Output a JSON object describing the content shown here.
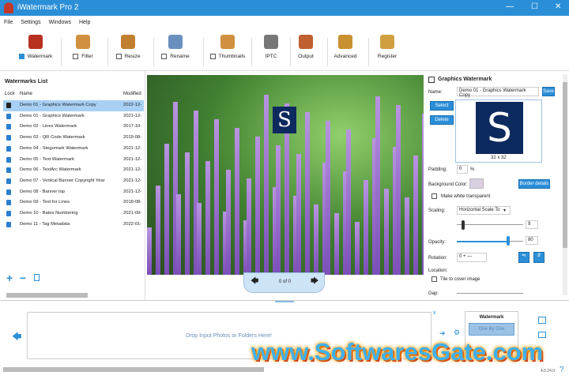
{
  "window": {
    "title": "iWatermark Pro 2",
    "minimize": "—",
    "maximize": "☐",
    "close": "✕"
  },
  "menu": [
    "File",
    "Settings",
    "Windows",
    "Help"
  ],
  "toolbar": [
    {
      "label": "Watermark",
      "checkbox": true,
      "checked": true,
      "icon": "stamp-icon"
    },
    {
      "label": "Filter",
      "checkbox": true,
      "checked": false,
      "icon": "funnel-icon"
    },
    {
      "label": "Resize",
      "checkbox": true,
      "checked": false,
      "icon": "resize-icon"
    },
    {
      "label": "Rename",
      "checkbox": true,
      "checked": false,
      "icon": "rename-icon"
    },
    {
      "label": "Thumbnails",
      "checkbox": true,
      "checked": false,
      "icon": "thumbnails-icon"
    },
    {
      "label": "IPTC",
      "checkbox": false,
      "icon": "id-card-icon"
    },
    {
      "label": "Output",
      "checkbox": false,
      "icon": "output-icon"
    },
    {
      "label": "Advanced",
      "checkbox": false,
      "icon": "gear-icon"
    },
    {
      "label": "Register",
      "checkbox": false,
      "icon": "key-icon"
    }
  ],
  "watermarks_list": {
    "title": "Watermarks List",
    "columns": [
      "Lock",
      "Name",
      "Modified"
    ],
    "rows": [
      {
        "name": "Demo 01 - Graphics Watermark Copy",
        "modified": "2022-12-",
        "selected": true,
        "locked": false
      },
      {
        "name": "Demo 01 - Graphics Watermark",
        "modified": "2021-12-",
        "locked": true
      },
      {
        "name": "Demo 02 - Lines Watermark",
        "modified": "2017-10-",
        "locked": true
      },
      {
        "name": "Demo 03 - QR Code Watermark",
        "modified": "2019-08-",
        "locked": true
      },
      {
        "name": "Demo 04 - Stegomark Watermark",
        "modified": "2021-12-",
        "locked": true
      },
      {
        "name": "Demo 05 - Text Watermark",
        "modified": "2021-12-",
        "locked": true
      },
      {
        "name": "Demo 06 - TextArc Watermark",
        "modified": "2021-12-",
        "locked": true
      },
      {
        "name": "Demo 07 - Vertical Banner Copyright Year",
        "modified": "2021-12-",
        "locked": true
      },
      {
        "name": "Demo 08 - Banner top",
        "modified": "2021-12-",
        "locked": true
      },
      {
        "name": "Demo 09 - Text for Lines",
        "modified": "2018-08-",
        "locked": true
      },
      {
        "name": "Demo 10 - Bates Numbering",
        "modified": "2021-09-",
        "locked": true
      },
      {
        "name": "Demo 11 - Tag Metadata",
        "modified": "2022-01-",
        "locked": true
      }
    ]
  },
  "preview": {
    "watermark_letter": "S",
    "pager": "0 of 0"
  },
  "graphics_watermark": {
    "title": "Graphics Watermark",
    "name_label": "Name:",
    "name_value": "Demo 01 - Graphics Watermark Copy",
    "save": "Save",
    "select": "Select",
    "delete": "Delete",
    "thumb_letter": "S",
    "thumb_size": "32 x 32",
    "padding_label": "Padding:",
    "padding_value": "0",
    "padding_unit": "%",
    "bg_color_label": "Background Color:",
    "bg_color": "#d8cfe0",
    "border_details": "Border details",
    "make_white_transparent": "Make white transparent",
    "scaling_label": "Scaling:",
    "scaling_value": "Horizontal Scale To",
    "scale_value": "9",
    "opacity_label": "Opacity:",
    "opacity_value": "80",
    "rotation_label": "Rotation:",
    "rotation_value": "0",
    "location_label": "Location:",
    "tile": "Tile to cover image",
    "gap_label": "Gap:"
  },
  "bottom": {
    "drop_text": "Drop Input Photos or Folders Here!",
    "close": "x",
    "mode_title": "Watermark",
    "mode_button": "One By One",
    "version": "4.0.24.0",
    "help": "?"
  },
  "overlay_watermark": "www.SoftwaresGate.com",
  "colors": {
    "accent": "#2b8fd8",
    "selection": "#a8d0f4"
  }
}
